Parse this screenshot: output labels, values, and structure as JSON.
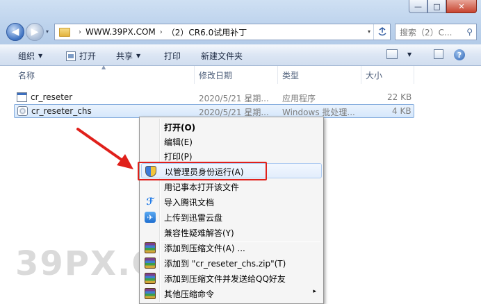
{
  "window": {
    "controls": {
      "minimize": "—",
      "maximize": "□",
      "close": "✕"
    }
  },
  "nav": {
    "back": "◀",
    "forward": "▶",
    "dropdown": "▾"
  },
  "address": {
    "crumbs": [
      "WWW.39PX.COM",
      "（2）CR6.0试用补丁"
    ],
    "separator": "›",
    "refresh_icon": "refresh-icon"
  },
  "search": {
    "placeholder": "搜索（2）C..."
  },
  "toolbar": {
    "organize": "组织",
    "open": "打开",
    "share": "共享",
    "print": "打印",
    "new_folder": "新建文件夹",
    "help": "?"
  },
  "columns": {
    "name": "名称",
    "modified": "修改日期",
    "type": "类型",
    "size": "大小"
  },
  "files": [
    {
      "name": "cr_reseter",
      "modified": "2020/5/21 星期...",
      "type": "应用程序",
      "size": "22 KB",
      "icon": "app-icon"
    },
    {
      "name": "cr_reseter_chs",
      "modified": "2020/5/21 星期...",
      "type": "Windows 批处理...",
      "size": "4 KB",
      "icon": "batch-icon"
    }
  ],
  "context_menu": {
    "items": [
      {
        "label": "打开(O)",
        "bold": true
      },
      {
        "label": "编辑(E)"
      },
      {
        "label": "打印(P)"
      },
      {
        "label": "以管理员身份运行(A)",
        "icon": "shield-icon",
        "highlighted": true
      },
      {
        "label": "用记事本打开该文件"
      },
      {
        "label": "导入腾讯文档",
        "icon": "tencent-docs-icon",
        "icon_glyph": "ℱ"
      },
      {
        "label": "上传到迅雷云盘",
        "icon": "xunlei-icon",
        "icon_glyph": "✈"
      },
      {
        "label": "兼容性疑难解答(Y)"
      },
      {
        "label": "添加到压缩文件(A) ...",
        "icon": "winrar-icon"
      },
      {
        "label": "添加到 \"cr_reseter_chs.zip\"(T)",
        "icon": "winrar-icon"
      },
      {
        "label": "添加到压缩文件并发送给QQ好友",
        "icon": "winrar-icon"
      },
      {
        "label": "其他压缩命令",
        "icon": "winrar-icon",
        "submenu": "▸"
      }
    ]
  },
  "watermark": "39PX.COM",
  "colors": {
    "highlight_box": "#e0201b",
    "accent": "#3d7ad8"
  }
}
